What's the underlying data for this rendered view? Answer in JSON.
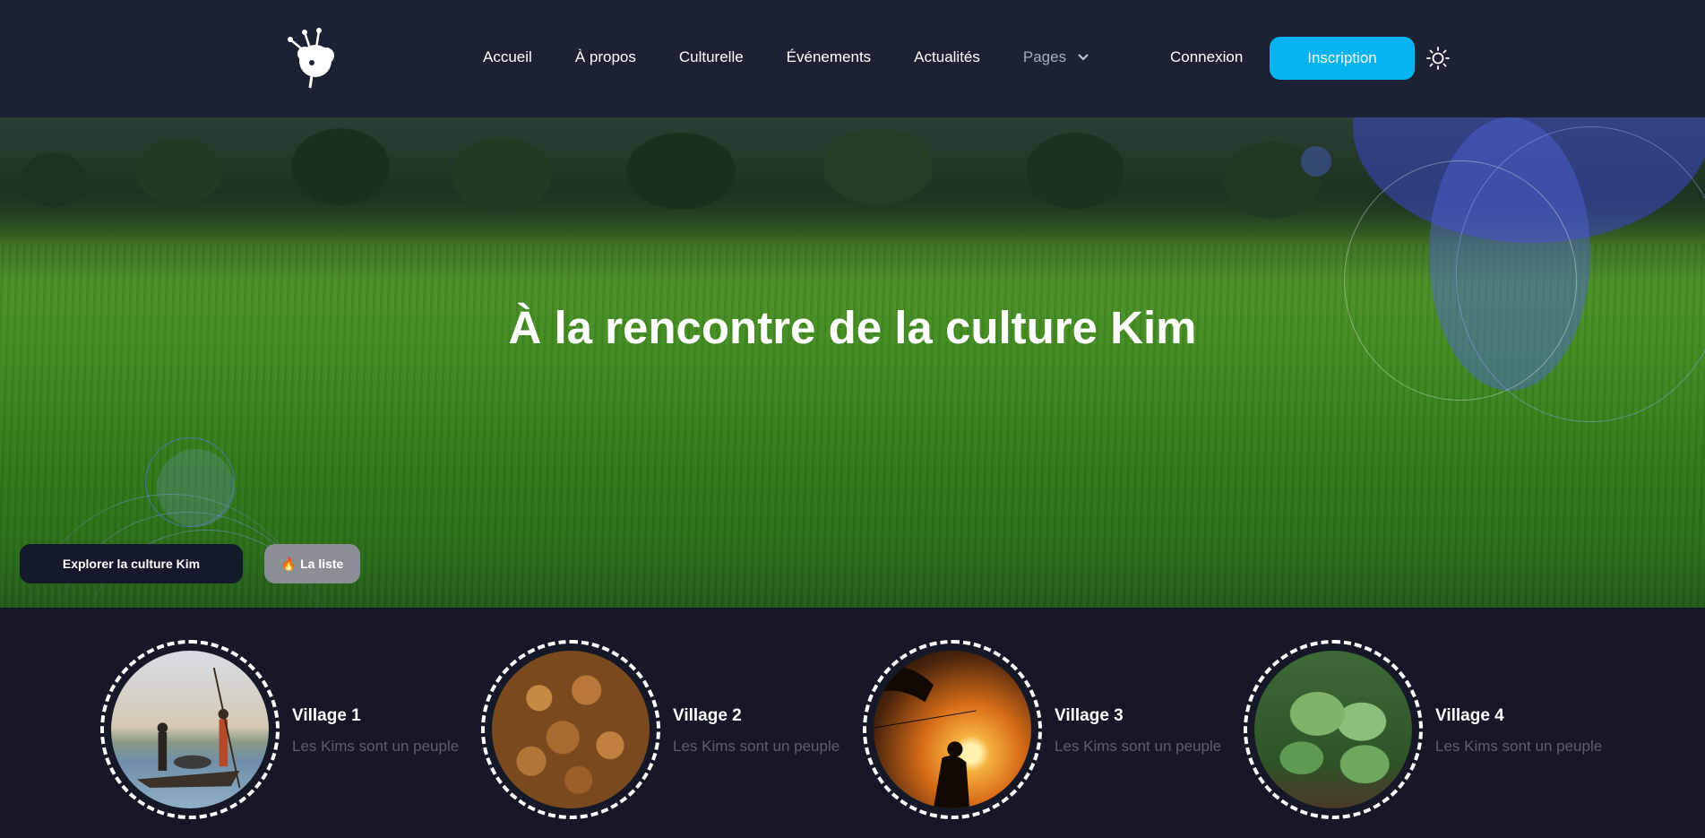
{
  "header": {
    "nav": [
      "Accueil",
      "À propos",
      "Culturelle",
      "Événements",
      "Actualités",
      "Pages"
    ],
    "connexion": "Connexion",
    "inscription": "Inscription"
  },
  "hero": {
    "title": "À la rencontre de la culture Kim",
    "explore_button": "Explorer la culture Kim",
    "list_button": "La liste"
  },
  "villages": [
    {
      "title": "Village 1",
      "desc": "Les Kims sont un peuple"
    },
    {
      "title": "Village 2",
      "desc": "Les Kims sont un peuple"
    },
    {
      "title": "Village 3",
      "desc": "Les Kims sont un peuple"
    },
    {
      "title": "Village 4",
      "desc": "Les Kims sont un peuple"
    }
  ],
  "colors": {
    "header_bg": "#1c2233",
    "page_bg": "#141827",
    "accent": "#05b3f0"
  }
}
